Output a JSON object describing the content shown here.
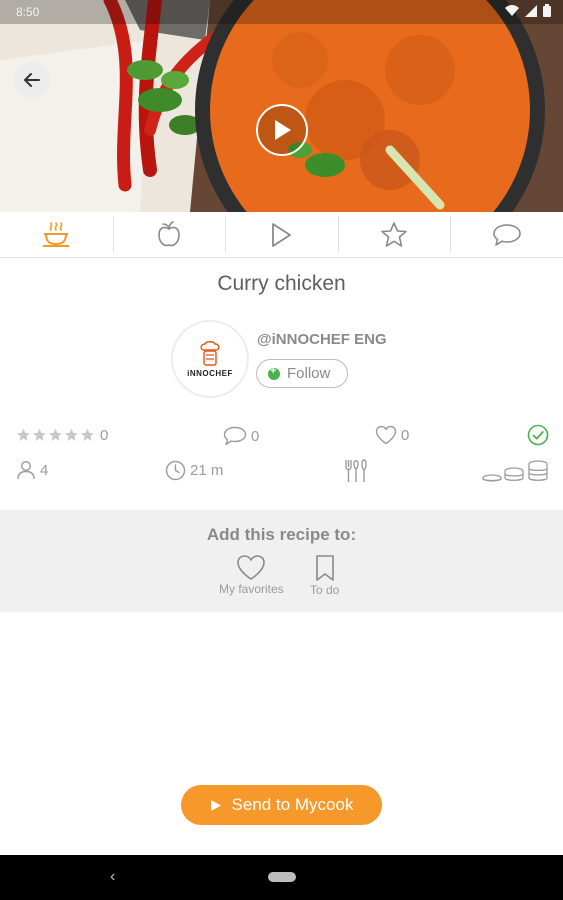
{
  "status_bar": {
    "time": "8:50"
  },
  "recipe": {
    "title": "Curry chicken",
    "author": "@iNNOCHEF ENG",
    "author_logo_text": "iNNOCHEF",
    "follow_label": "Follow"
  },
  "tabs": [
    {
      "icon": "cooking-pot-icon",
      "active": true
    },
    {
      "icon": "apple-icon",
      "active": false
    },
    {
      "icon": "play-icon",
      "active": false
    },
    {
      "icon": "star-icon",
      "active": false
    },
    {
      "icon": "comment-icon",
      "active": false
    }
  ],
  "stats": {
    "rating_value": "0",
    "rating_stars": 0,
    "comments": "0",
    "likes": "0",
    "servings": "4",
    "time": "21 m"
  },
  "add_section": {
    "title": "Add this recipe to:",
    "favorites_label": "My favorites",
    "todo_label": "To do"
  },
  "send_button": {
    "label": "Send to Mycook"
  },
  "colors": {
    "accent": "#f7982a",
    "check_green": "#4caf50",
    "text_gray": "#8a8a8a"
  }
}
